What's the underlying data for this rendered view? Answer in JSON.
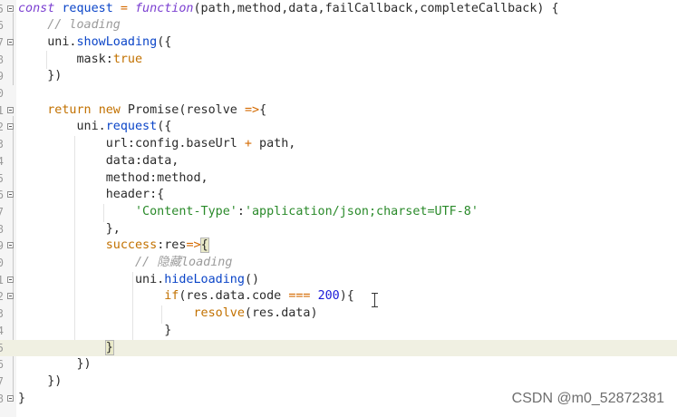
{
  "editor": {
    "lines": [
      {
        "n": "5",
        "fold": true,
        "tokens": [
          {
            "t": "const",
            "c": "kwi"
          },
          {
            "t": " request ",
            "c": "fn"
          },
          {
            "t": "= ",
            "c": "op"
          },
          {
            "t": "function",
            "c": "kwi"
          },
          {
            "t": "(path,method,data,failCallback,completeCallback) {",
            "c": "plain"
          }
        ]
      },
      {
        "n": "6",
        "fold": false,
        "tokens": [
          {
            "t": "    ",
            "c": "plain"
          },
          {
            "t": "// loading",
            "c": "cmt"
          }
        ]
      },
      {
        "n": "7",
        "fold": true,
        "tokens": [
          {
            "t": "    uni.",
            "c": "plain"
          },
          {
            "t": "showLoading",
            "c": "fn"
          },
          {
            "t": "({",
            "c": "plain"
          }
        ]
      },
      {
        "n": "8",
        "fold": false,
        "tokens": [
          {
            "t": "        mask:",
            "c": "plain"
          },
          {
            "t": "true",
            "c": "kw"
          }
        ]
      },
      {
        "n": "9",
        "fold": false,
        "tokens": [
          {
            "t": "    })",
            "c": "plain"
          }
        ]
      },
      {
        "n": "0",
        "fold": false,
        "tokens": []
      },
      {
        "n": "1",
        "fold": true,
        "tokens": [
          {
            "t": "    ",
            "c": "plain"
          },
          {
            "t": "return",
            "c": "kw"
          },
          {
            "t": " ",
            "c": "plain"
          },
          {
            "t": "new",
            "c": "kw"
          },
          {
            "t": " Promise(resolve ",
            "c": "plain"
          },
          {
            "t": "=>",
            "c": "op"
          },
          {
            "t": "{",
            "c": "plain"
          }
        ]
      },
      {
        "n": "2",
        "fold": true,
        "tokens": [
          {
            "t": "        uni.",
            "c": "plain"
          },
          {
            "t": "request",
            "c": "fn"
          },
          {
            "t": "({",
            "c": "plain"
          }
        ]
      },
      {
        "n": "3",
        "fold": false,
        "tokens": [
          {
            "t": "            url:config.baseUrl ",
            "c": "plain"
          },
          {
            "t": "+",
            "c": "op"
          },
          {
            "t": " path,",
            "c": "plain"
          }
        ]
      },
      {
        "n": "4",
        "fold": false,
        "tokens": [
          {
            "t": "            data:data,",
            "c": "plain"
          }
        ]
      },
      {
        "n": "5",
        "fold": false,
        "tokens": [
          {
            "t": "            method:method,",
            "c": "plain"
          }
        ]
      },
      {
        "n": "6",
        "fold": true,
        "tokens": [
          {
            "t": "            header:{",
            "c": "plain"
          }
        ]
      },
      {
        "n": "7",
        "fold": false,
        "tokens": [
          {
            "t": "                ",
            "c": "plain"
          },
          {
            "t": "'Content-Type'",
            "c": "str"
          },
          {
            "t": ":",
            "c": "plain"
          },
          {
            "t": "'application/json;charset=UTF-8'",
            "c": "str"
          }
        ]
      },
      {
        "n": "8",
        "fold": false,
        "tokens": [
          {
            "t": "            },",
            "c": "plain"
          }
        ]
      },
      {
        "n": "9",
        "fold": true,
        "tokens": [
          {
            "t": "            ",
            "c": "plain"
          },
          {
            "t": "success",
            "c": "kw"
          },
          {
            "t": ":res",
            "c": "plain"
          },
          {
            "t": "=>",
            "c": "op"
          },
          {
            "t": "{",
            "c": "bracket-match"
          }
        ]
      },
      {
        "n": "0",
        "fold": false,
        "tokens": [
          {
            "t": "                ",
            "c": "plain"
          },
          {
            "t": "// 隐藏loading",
            "c": "cmt"
          }
        ]
      },
      {
        "n": "1",
        "fold": true,
        "tokens": [
          {
            "t": "                uni.",
            "c": "plain"
          },
          {
            "t": "hideLoading",
            "c": "fn"
          },
          {
            "t": "()",
            "c": "plain"
          }
        ]
      },
      {
        "n": "2",
        "fold": true,
        "tokens": [
          {
            "t": "                    ",
            "c": "plain"
          },
          {
            "t": "if",
            "c": "kw"
          },
          {
            "t": "(res.data.code ",
            "c": "plain"
          },
          {
            "t": "===",
            "c": "op"
          },
          {
            "t": " ",
            "c": "plain"
          },
          {
            "t": "200",
            "c": "num"
          },
          {
            "t": "){",
            "c": "plain"
          }
        ]
      },
      {
        "n": "3",
        "fold": false,
        "tokens": [
          {
            "t": "                        ",
            "c": "plain"
          },
          {
            "t": "resolve",
            "c": "kw"
          },
          {
            "t": "(res.data)",
            "c": "plain"
          }
        ]
      },
      {
        "n": "4",
        "fold": false,
        "tokens": [
          {
            "t": "                    }",
            "c": "plain"
          }
        ]
      },
      {
        "n": "5",
        "fold": false,
        "current": true,
        "tokens": [
          {
            "t": "            ",
            "c": "plain"
          },
          {
            "t": "}",
            "c": "bracket-match"
          }
        ]
      },
      {
        "n": "6",
        "fold": false,
        "tokens": [
          {
            "t": "        })",
            "c": "plain"
          }
        ]
      },
      {
        "n": "7",
        "fold": false,
        "tokens": [
          {
            "t": "    })",
            "c": "plain"
          }
        ]
      },
      {
        "n": "8",
        "fold": true,
        "tokens": [
          {
            "t": "}",
            "c": "plain"
          }
        ]
      }
    ]
  },
  "watermark": "CSDN @m0_52872381"
}
